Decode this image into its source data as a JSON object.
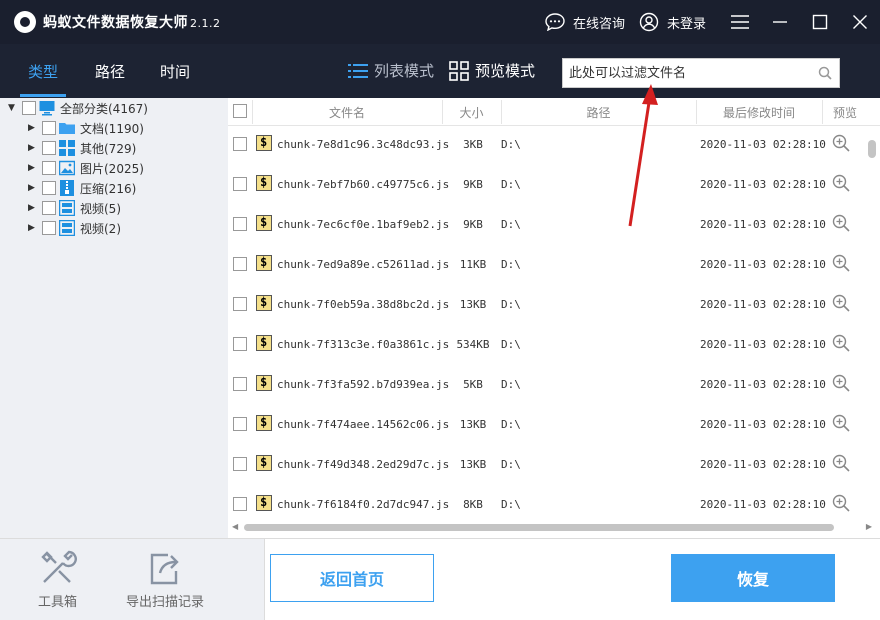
{
  "app": {
    "title": "蚂蚁文件数据恢复大师",
    "version": "2.1.2",
    "online_consult": "在线咨询",
    "login_status": "未登录"
  },
  "nav": {
    "tabs": [
      {
        "label": "类型"
      },
      {
        "label": "路径"
      },
      {
        "label": "时间"
      }
    ],
    "list_mode": "列表模式",
    "preview_mode": "预览模式"
  },
  "search": {
    "placeholder": "此处可以过滤文件名"
  },
  "sidebar": {
    "root": "全部分类(4167)",
    "items": [
      {
        "label": "文档(1190)",
        "icon": "folder-icon",
        "color": "#3da1f0"
      },
      {
        "label": "其他(729)",
        "icon": "grid-icon",
        "color": "#1e90e0"
      },
      {
        "label": "图片(2025)",
        "icon": "image-icon",
        "color": "#1e90e0"
      },
      {
        "label": "压缩(216)",
        "icon": "archive-icon",
        "color": "#1e90e0"
      },
      {
        "label": "视频(5)",
        "icon": "video-icon",
        "color": "#1e90e0"
      },
      {
        "label": "视频(2)",
        "icon": "video-icon",
        "color": "#1e90e0"
      }
    ]
  },
  "table": {
    "columns": {
      "name": "文件名",
      "size": "大小",
      "path": "路径",
      "modified": "最后修改时间",
      "preview": "预览"
    },
    "rows": [
      {
        "name": "chunk-7e8d1c96.3c48dc93.js",
        "size": "3KB",
        "path": "D:\\",
        "modified": "2020-11-03 02:28:10"
      },
      {
        "name": "chunk-7ebf7b60.c49775c6.js",
        "size": "9KB",
        "path": "D:\\",
        "modified": "2020-11-03 02:28:10"
      },
      {
        "name": "chunk-7ec6cf0e.1baf9eb2.js",
        "size": "9KB",
        "path": "D:\\",
        "modified": "2020-11-03 02:28:10"
      },
      {
        "name": "chunk-7ed9a89e.c52611ad.js",
        "size": "11KB",
        "path": "D:\\",
        "modified": "2020-11-03 02:28:10"
      },
      {
        "name": "chunk-7f0eb59a.38d8bc2d.js",
        "size": "13KB",
        "path": "D:\\",
        "modified": "2020-11-03 02:28:10"
      },
      {
        "name": "chunk-7f313c3e.f0a3861c.js",
        "size": "534KB",
        "path": "D:\\",
        "modified": "2020-11-03 02:28:10"
      },
      {
        "name": "chunk-7f3fa592.b7d939ea.js",
        "size": "5KB",
        "path": "D:\\",
        "modified": "2020-11-03 02:28:10"
      },
      {
        "name": "chunk-7f474aee.14562c06.js",
        "size": "13KB",
        "path": "D:\\",
        "modified": "2020-11-03 02:28:10"
      },
      {
        "name": "chunk-7f49d348.2ed29d7c.js",
        "size": "13KB",
        "path": "D:\\",
        "modified": "2020-11-03 02:28:10"
      },
      {
        "name": "chunk-7f6184f0.2d7dc947.js",
        "size": "8KB",
        "path": "D:\\",
        "modified": "2020-11-03 02:28:10"
      }
    ]
  },
  "bottom": {
    "toolbox": "工具箱",
    "export_record": "导出扫描记录",
    "back_home": "返回首页",
    "recover": "恢复"
  },
  "colors": {
    "accent": "#3da1f0",
    "titlebar": "#1a1f2e",
    "arrow": "#d32020"
  }
}
